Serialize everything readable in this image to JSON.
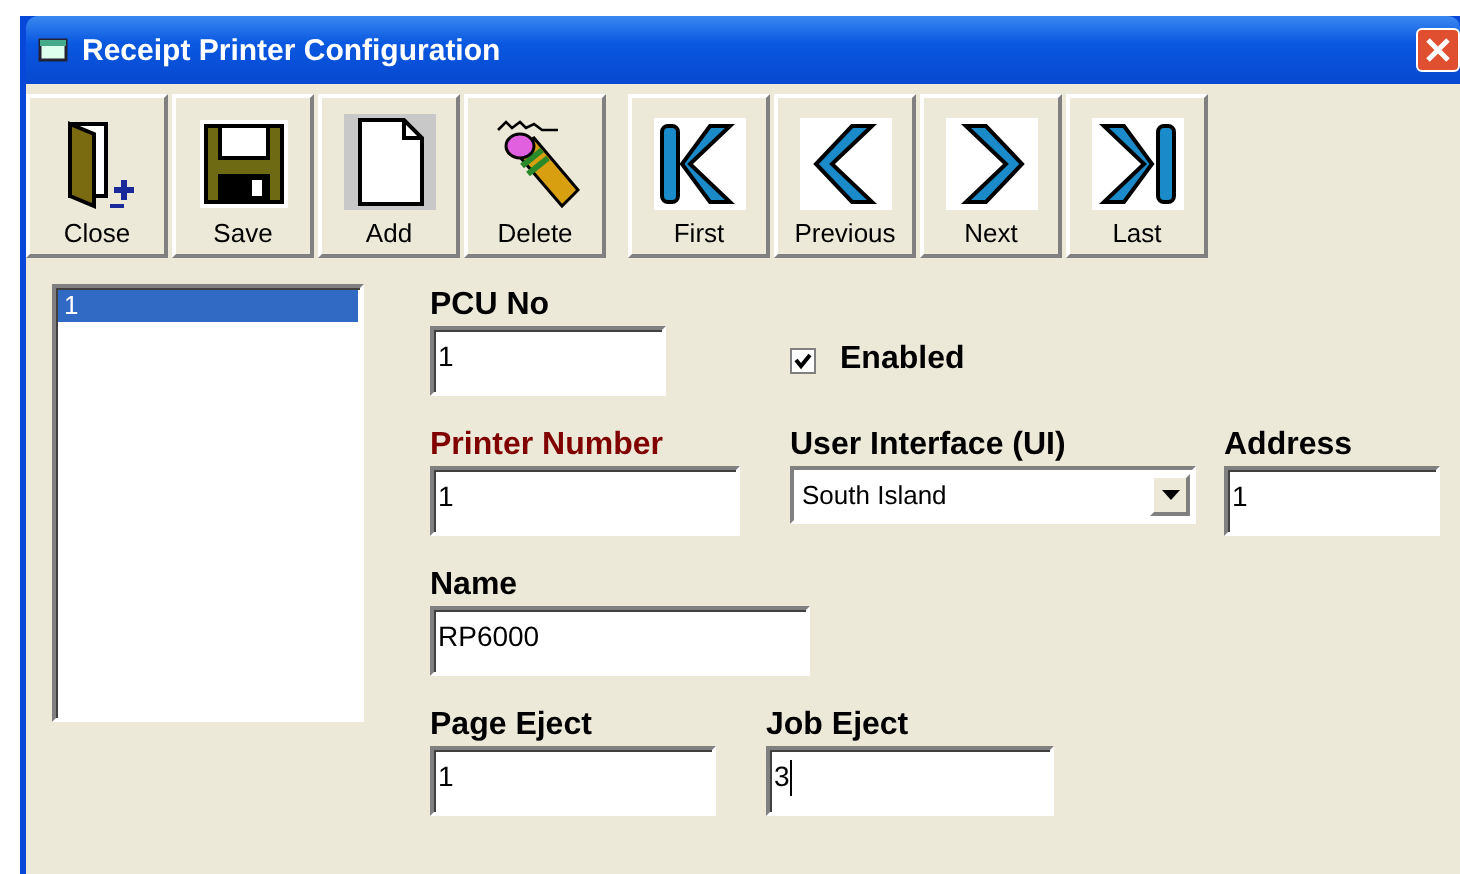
{
  "window": {
    "title": "Receipt Printer Configuration"
  },
  "toolbar": {
    "groups": [
      [
        {
          "label": "Close",
          "kind": "door"
        },
        {
          "label": "Save",
          "kind": "disk"
        },
        {
          "label": "Add",
          "kind": "page"
        },
        {
          "label": "Delete",
          "kind": "eraser"
        }
      ],
      [
        {
          "label": "First",
          "kind": "first"
        },
        {
          "label": "Previous",
          "kind": "previous"
        },
        {
          "label": "Next",
          "kind": "next"
        },
        {
          "label": "Last",
          "kind": "last"
        }
      ]
    ]
  },
  "record_list": {
    "items": [
      {
        "text": "1",
        "selected": true
      }
    ]
  },
  "form": {
    "rows": [
      [
        {
          "kind": "text",
          "label": "PCU No",
          "value": "1",
          "required": false,
          "focused": false
        },
        {
          "kind": "checkbox",
          "label": "Enabled",
          "checked": true
        }
      ],
      [
        {
          "kind": "text",
          "label": "Printer Number",
          "value": "1",
          "required": true,
          "focused": false
        },
        {
          "kind": "combo",
          "label": "User Interface (UI)",
          "value": "South Island",
          "required": false
        },
        {
          "kind": "text",
          "label": "Address",
          "value": "1",
          "required": false,
          "focused": false
        }
      ],
      [
        {
          "kind": "text",
          "label": "Name",
          "value": "RP6000",
          "required": false,
          "focused": false
        }
      ],
      [
        {
          "kind": "text",
          "label": "Page Eject",
          "value": "1",
          "required": false,
          "focused": false
        },
        {
          "kind": "text",
          "label": "Job Eject",
          "value": "3",
          "required": false,
          "focused": true
        }
      ]
    ]
  }
}
